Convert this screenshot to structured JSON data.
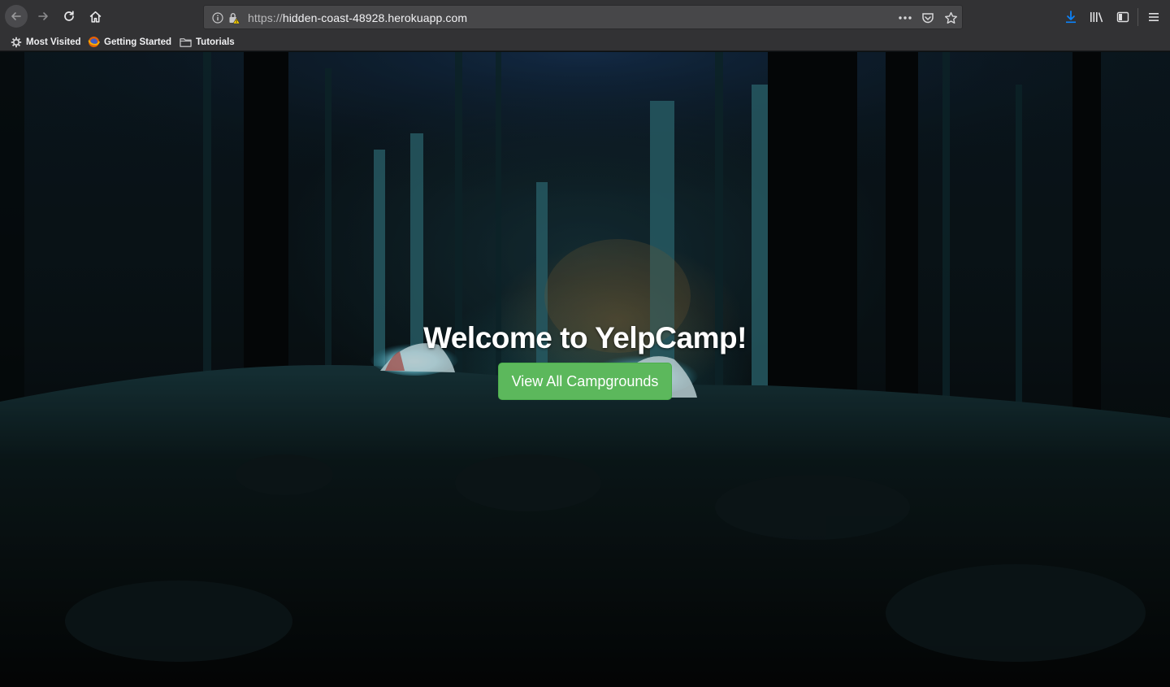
{
  "browser": {
    "url_scheme": "https://",
    "url_host": "hidden-coast-48928.herokuapp.com",
    "bookmarks": [
      {
        "label": "Most Visited",
        "icon": "gear-icon"
      },
      {
        "label": "Getting Started",
        "icon": "firefox-icon"
      },
      {
        "label": "Tutorials",
        "icon": "folder-icon"
      }
    ],
    "accent_color": "#0a84ff"
  },
  "page": {
    "title": "Welcome to YelpCamp!",
    "cta_label": "View All Campgrounds",
    "cta_color": "#5cb85c",
    "background": "night forest campsite with glowing tents"
  }
}
